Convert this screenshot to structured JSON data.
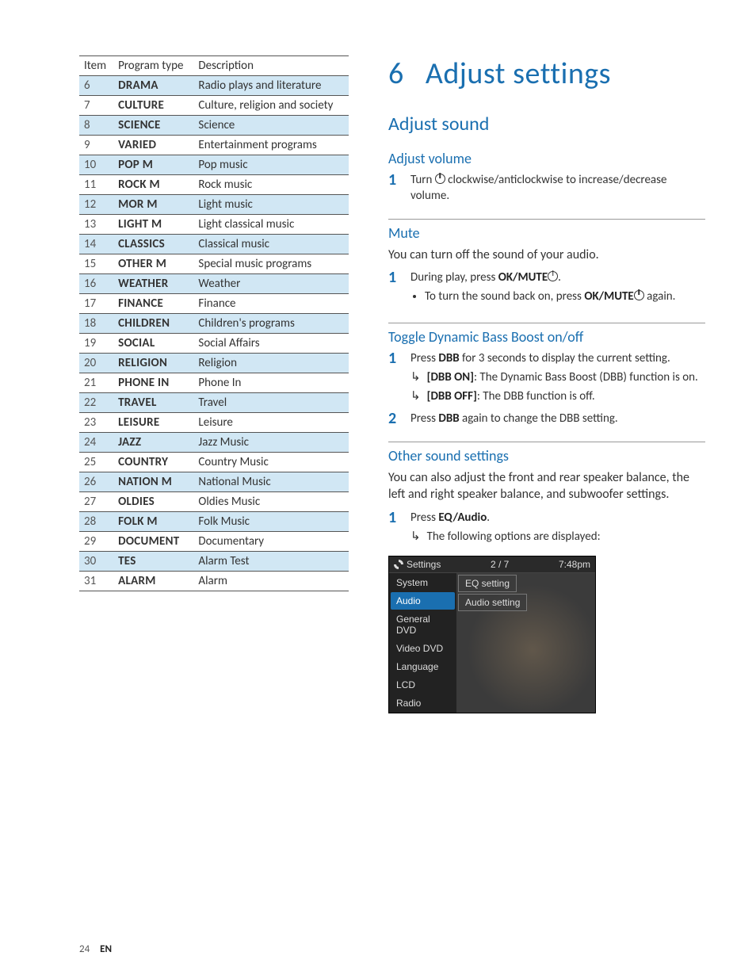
{
  "footer": {
    "page": "24",
    "lang": "EN"
  },
  "table": {
    "headers": [
      "Item",
      "Program type",
      "Description"
    ],
    "rows": [
      {
        "item": "6",
        "type": "DRAMA",
        "desc": "Radio plays and literature"
      },
      {
        "item": "7",
        "type": "CULTURE",
        "desc": "Culture, religion and society"
      },
      {
        "item": "8",
        "type": "SCIENCE",
        "desc": "Science"
      },
      {
        "item": "9",
        "type": "VARIED",
        "desc": "Entertainment programs"
      },
      {
        "item": "10",
        "type": "POP M",
        "desc": "Pop music"
      },
      {
        "item": "11",
        "type": "ROCK M",
        "desc": "Rock music"
      },
      {
        "item": "12",
        "type": "MOR M",
        "desc": "Light music"
      },
      {
        "item": "13",
        "type": "LIGHT M",
        "desc": "Light classical music"
      },
      {
        "item": "14",
        "type": "CLASSICS",
        "desc": "Classical music"
      },
      {
        "item": "15",
        "type": "OTHER M",
        "desc": "Special music programs"
      },
      {
        "item": "16",
        "type": "WEATHER",
        "desc": "Weather"
      },
      {
        "item": "17",
        "type": "FINANCE",
        "desc": "Finance"
      },
      {
        "item": "18",
        "type": "CHILDREN",
        "desc": "Children's programs"
      },
      {
        "item": "19",
        "type": "SOCIAL",
        "desc": "Social Affairs"
      },
      {
        "item": "20",
        "type": "RELIGION",
        "desc": "Religion"
      },
      {
        "item": "21",
        "type": "PHONE IN",
        "desc": "Phone In"
      },
      {
        "item": "22",
        "type": "TRAVEL",
        "desc": "Travel"
      },
      {
        "item": "23",
        "type": "LEISURE",
        "desc": "Leisure"
      },
      {
        "item": "24",
        "type": "JAZZ",
        "desc": "Jazz Music"
      },
      {
        "item": "25",
        "type": "COUNTRY",
        "desc": "Country Music"
      },
      {
        "item": "26",
        "type": "NATION M",
        "desc": "National Music"
      },
      {
        "item": "27",
        "type": "OLDIES",
        "desc": "Oldies Music"
      },
      {
        "item": "28",
        "type": "FOLK M",
        "desc": "Folk Music"
      },
      {
        "item": "29",
        "type": "DOCUMENT",
        "desc": "Documentary"
      },
      {
        "item": "30",
        "type": "TES",
        "desc": "Alarm Test"
      },
      {
        "item": "31",
        "type": "ALARM",
        "desc": "Alarm"
      }
    ]
  },
  "chapter": {
    "number": "6",
    "title": "Adjust settings"
  },
  "section1": {
    "title": "Adjust sound",
    "sub1": {
      "title": "Adjust volume",
      "step1_pre": "Turn ",
      "step1_post": " clockwise/anticlockwise to increase/decrease volume."
    },
    "sub2": {
      "title": "Mute",
      "intro": "You can turn off the sound of your audio.",
      "step1_pre": "During play, press ",
      "step1_label": "OK/MUTE",
      "bullet_pre": "To turn the sound back on, press ",
      "bullet_label": "OK/MUTE",
      "bullet_post": " again."
    },
    "sub3": {
      "title": "Toggle Dynamic Bass Boost on/off",
      "step1_a": "Press ",
      "step1_b": "DBB",
      "step1_c": " for 3 seconds to display the current setting.",
      "result1_label": "[DBB ON]",
      "result1_text": ": The Dynamic Bass Boost (DBB) function is on.",
      "result2_label": "[DBB OFF]",
      "result2_text": ": The DBB function is off.",
      "step2_a": "Press ",
      "step2_b": "DBB",
      "step2_c": " again to change the DBB setting."
    },
    "sub4": {
      "title": "Other sound settings",
      "intro": "You can also adjust the front and rear speaker balance, the left and right speaker balance, and subwoofer settings.",
      "step1_a": "Press ",
      "step1_b": "EQ/Audio",
      "step1_c": ".",
      "result": "The following options are displayed:"
    }
  },
  "menu": {
    "title": "Settings",
    "pager": "2 / 7",
    "time": "7:48pm",
    "side": [
      "System",
      "Audio",
      "General DVD",
      "Video DVD",
      "Language",
      "LCD",
      "Radio"
    ],
    "selected": "Audio",
    "options": [
      "EQ setting",
      "Audio setting"
    ]
  }
}
